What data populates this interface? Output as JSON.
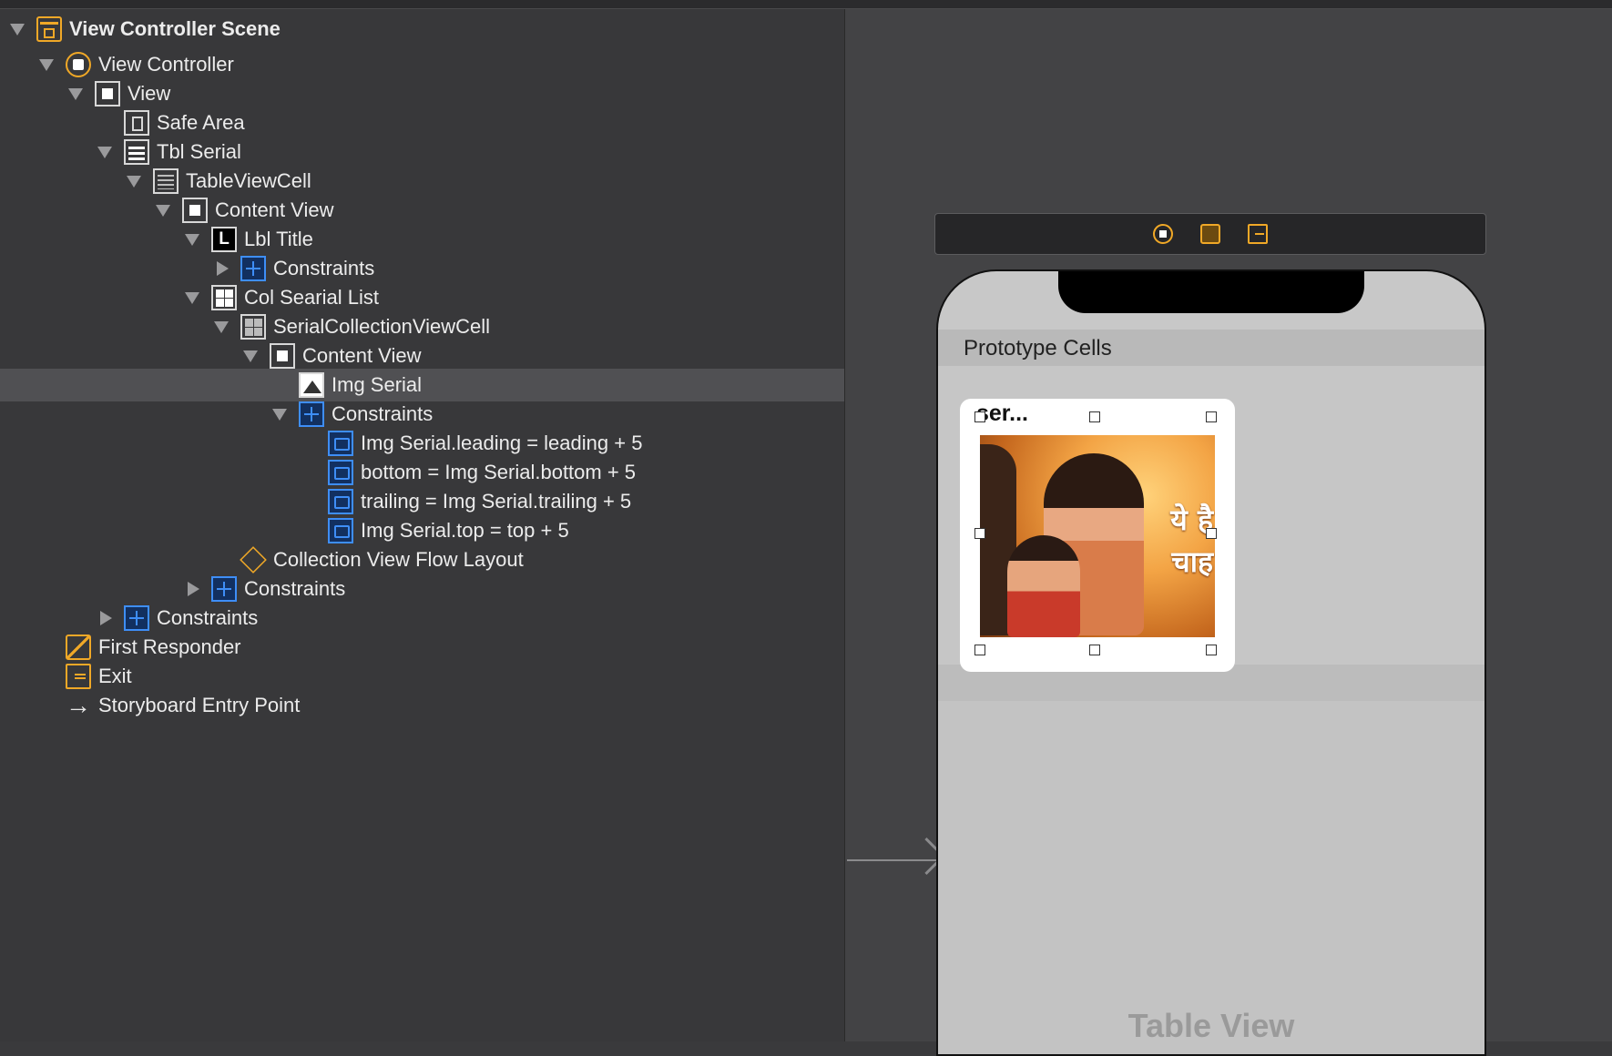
{
  "outline": {
    "rows": [
      {
        "label": "View Controller Scene",
        "icon": "scene-icon",
        "bold": true
      },
      {
        "label": "View Controller",
        "icon": "view-controller-icon"
      },
      {
        "label": "View",
        "icon": "view-icon"
      },
      {
        "label": "Safe Area",
        "icon": "safe-area-icon"
      },
      {
        "label": "Tbl Serial",
        "icon": "table-view-icon"
      },
      {
        "label": "TableViewCell",
        "icon": "table-cell-icon"
      },
      {
        "label": "Content View",
        "icon": "view-icon"
      },
      {
        "label": "Lbl Title",
        "icon": "label-icon"
      },
      {
        "label": "Constraints",
        "icon": "constraints-icon"
      },
      {
        "label": "Col Searial List",
        "icon": "collection-view-icon"
      },
      {
        "label": "SerialCollectionViewCell",
        "icon": "collection-cell-icon"
      },
      {
        "label": "Content View",
        "icon": "view-icon"
      },
      {
        "label": "Img Serial",
        "icon": "image-view-icon",
        "selected": true
      },
      {
        "label": "Constraints",
        "icon": "constraints-icon"
      },
      {
        "label": "Img Serial.leading = leading + 5",
        "icon": "leading-constraint-icon"
      },
      {
        "label": "bottom = Img Serial.bottom + 5",
        "icon": "bottom-constraint-icon"
      },
      {
        "label": "trailing = Img Serial.trailing + 5",
        "icon": "trailing-constraint-icon"
      },
      {
        "label": "Img Serial.top = top + 5",
        "icon": "top-constraint-icon"
      },
      {
        "label": "Collection View Flow Layout",
        "icon": "flow-layout-icon"
      },
      {
        "label": "Constraints",
        "icon": "constraints-icon"
      },
      {
        "label": "Constraints",
        "icon": "constraints-icon"
      },
      {
        "label": "First Responder",
        "icon": "first-responder-icon"
      },
      {
        "label": "Exit",
        "icon": "exit-icon"
      },
      {
        "label": "Storyboard Entry Point",
        "icon": "arrow-right-icon"
      }
    ]
  },
  "canvas": {
    "prototype_cells_label": "Prototype Cells",
    "cell_title": "ser...",
    "poster_text_line1": "ये है",
    "poster_text_line2": "चाह",
    "table_view_label": "Table View"
  },
  "colors": {
    "accent_orange": "#f0a827",
    "constraint_blue": "#3e8ef7",
    "selected_row": "#505053"
  }
}
